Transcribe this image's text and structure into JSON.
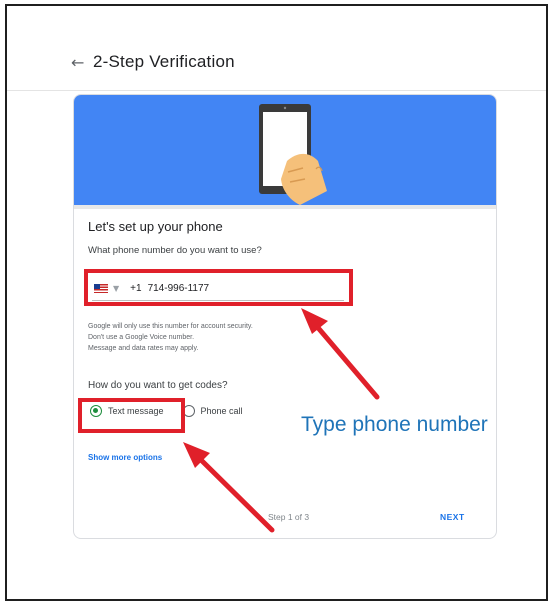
{
  "page": {
    "back_icon": "arrow-left-icon",
    "title": "2-Step Verification"
  },
  "card": {
    "banner_icon": "phone-in-hand-illustration",
    "banner_color": "#4285f4",
    "setup_title": "Let's set up your phone",
    "phone_question": "What phone number do you want to use?",
    "phone": {
      "country_flag_icon": "us-flag-icon",
      "dropdown_icon": "caret-down-icon",
      "country_code": "+1",
      "number": "714-996-1177"
    },
    "disclaimer": {
      "line1": "Google will only use this number for account security.",
      "line2": "Don't use a Google Voice number.",
      "line3": "Message and data rates may apply."
    },
    "codes_question": "How do you want to get codes?",
    "options": [
      {
        "label": "Text message",
        "selected": true
      },
      {
        "label": "Phone call",
        "selected": false
      }
    ],
    "show_more_label": "Show more options",
    "step_label": "Step 1 of 3",
    "next_label": "NEXT"
  },
  "annotation": {
    "caption": "Type phone number",
    "highlight_color": "#e0202a",
    "caption_color": "#1f74b8"
  }
}
